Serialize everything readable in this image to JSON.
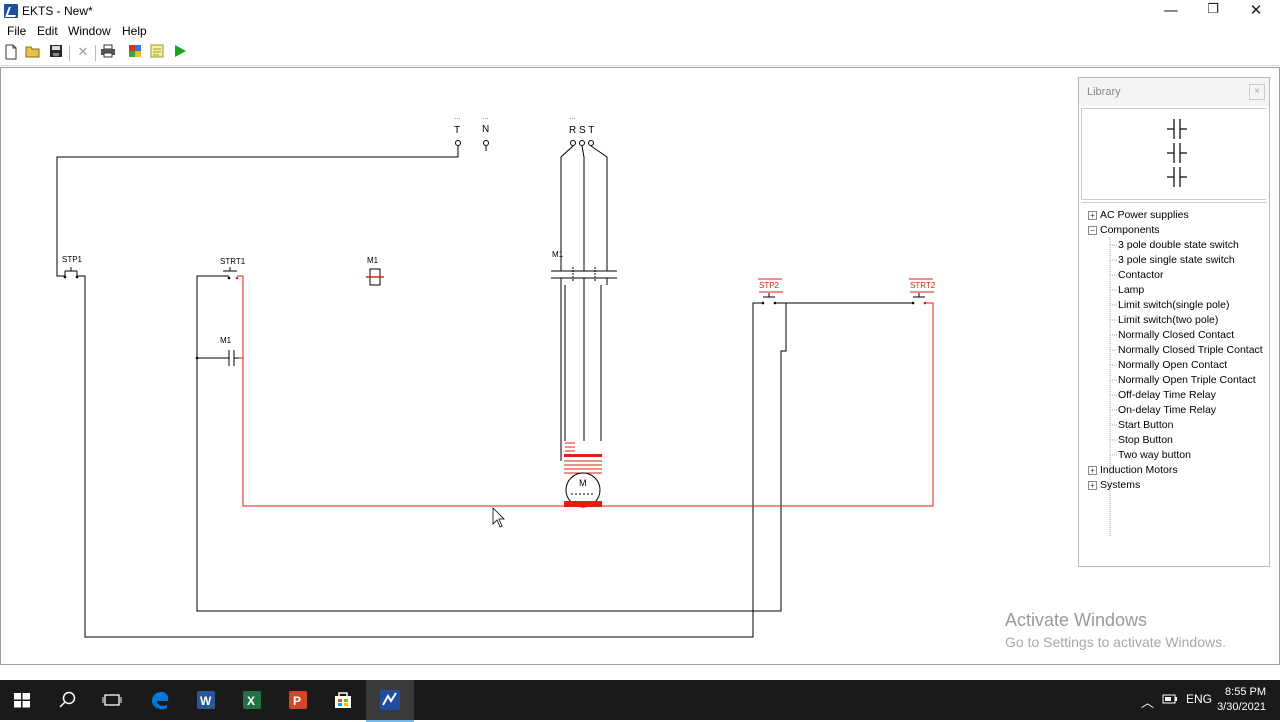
{
  "window": {
    "title": "EKTS - New*",
    "minimize_glyph": "—",
    "restore_glyph": "❐",
    "close_glyph": "✕"
  },
  "menu": {
    "items": [
      "File",
      "Edit",
      "Window",
      "Help"
    ]
  },
  "toolbar": {
    "icons": [
      "new-file-icon",
      "open-folder-icon",
      "save-icon",
      "delete-icon",
      "print-icon",
      "component-colors-icon",
      "notes-icon",
      "run-icon"
    ]
  },
  "diagram": {
    "terminal_labels": {
      "t": "T",
      "n": "N",
      "rst": "R S T",
      "dots": "..."
    },
    "component_labels": {
      "stp1": "STP1",
      "strt1": "STRT1",
      "m1_coil": "M1",
      "m1_hold": "M1",
      "m1_main": "M1",
      "stp2": "STP2",
      "strt2": "STRT2",
      "motor": "M"
    },
    "wire_colors": {
      "idle": "#000000",
      "energized": "#e02010"
    }
  },
  "library": {
    "title": "Library",
    "close_glyph": "×",
    "groups": [
      {
        "label": "AC Power supplies",
        "expanded": false,
        "items": []
      },
      {
        "label": "Components",
        "expanded": true,
        "items": [
          "3 pole double state switch",
          "3 pole single state switch",
          "Contactor",
          "Lamp",
          "Limit switch(single pole)",
          "Limit switch(two pole)",
          "Normally Closed Contact",
          "Normally Closed Triple Contact",
          "Normally Open Contact",
          "Normally Open Triple Contact",
          "Off-delay Time Relay",
          "On-delay Time Relay",
          "Start Button",
          "Stop Button",
          "Two way button"
        ]
      },
      {
        "label": "Induction Motors",
        "expanded": false,
        "items": []
      },
      {
        "label": "Systems",
        "expanded": false,
        "items": []
      }
    ]
  },
  "watermark": {
    "line1": "Activate Windows",
    "line2": "Go to Settings to activate Windows."
  },
  "taskbar": {
    "apps": [
      "windows-start-icon",
      "search-icon",
      "task-view-icon",
      "edge-icon",
      "word-icon",
      "excel-icon",
      "powerpoint-icon",
      "store-icon",
      "ekts-icon"
    ],
    "language": "ENG",
    "time": "8:55 PM",
    "date": "3/30/2021"
  },
  "colors": {
    "accent_red": "#e02010",
    "word_blue": "#2b579a",
    "excel_green": "#217346",
    "ppt_orange": "#d24726",
    "edge_blue": "#0078d7",
    "run_green": "#1aa31a"
  }
}
